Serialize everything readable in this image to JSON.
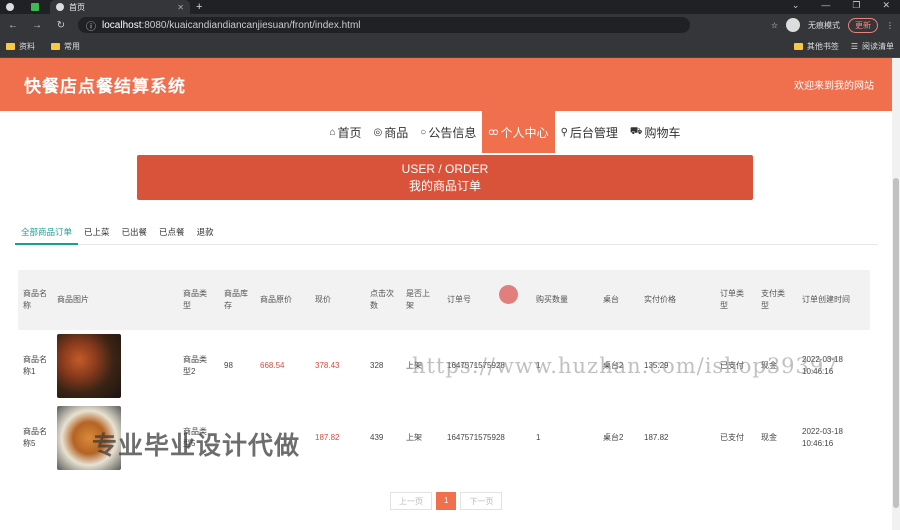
{
  "browser": {
    "tab_title": "首页",
    "url_host": "localhost",
    "url_rest": ":8080/kuaicandiandiancanjiesuan/front/index.html",
    "incognito_label": "无痕模式",
    "update_label": "更新",
    "bookmarks": [
      "资料",
      "常用"
    ],
    "bookmarks_right": [
      "其他书签",
      "阅读清单"
    ]
  },
  "site": {
    "title": "快餐店点餐结算系统",
    "welcome": "欢迎来到我的网站"
  },
  "nav": [
    {
      "icon": "home-icon",
      "glyph": "⌂",
      "label": "首页"
    },
    {
      "icon": "goods-icon",
      "glyph": "◎",
      "label": "商品"
    },
    {
      "icon": "notice-icon",
      "glyph": "○",
      "label": "公告信息"
    },
    {
      "icon": "user-icon",
      "glyph": "ꝏ",
      "label": "个人中心"
    },
    {
      "icon": "admin-icon",
      "glyph": "⚲",
      "label": "后台管理"
    },
    {
      "icon": "cart-icon",
      "glyph": "⛟",
      "label": "购物车"
    }
  ],
  "banner": {
    "line1": "USER / ORDER",
    "line2": "我的商品订单"
  },
  "order_tabs": [
    "全部商品订单",
    "已上菜",
    "已出餐",
    "已点餐",
    "退款"
  ],
  "table": {
    "headers": [
      "商品名称",
      "商品图片",
      "商品类型",
      "商品库存",
      "商品原价",
      "现价",
      "点击次数",
      "是否上架",
      "订单号",
      "",
      "购买数量",
      "桌台",
      "实付价格",
      "订单类型",
      "支付类型",
      "订单创建时间"
    ],
    "rows": [
      {
        "name": "商品名称1",
        "type": "商品类型2",
        "stock": "98",
        "orig_price": "668.54",
        "price": "378.43",
        "clicks": "328",
        "on_shelf": "上架",
        "order_no": "1647571575928",
        "qty": "1",
        "table": "桌台2",
        "paid": "135.29",
        "order_type": "已支付",
        "pay_type": "现金",
        "created": "2022-03-18 10:46:16"
      },
      {
        "name": "商品名称5",
        "type": "商品类型5",
        "stock": "",
        "orig_price": "",
        "price": "187.82",
        "clicks": "439",
        "on_shelf": "上架",
        "order_no": "1647571575928",
        "qty": "1",
        "table": "桌台2",
        "paid": "187.82",
        "order_type": "已支付",
        "pay_type": "现金",
        "created": "2022-03-18 10:46:16"
      }
    ]
  },
  "pager": {
    "prev": "上一页",
    "current": "1",
    "next": "下一页"
  },
  "watermarks": {
    "url": "https://www.huzhan.com/ishop39397",
    "promo": "专业毕业设计代做"
  },
  "colors": {
    "primary": "#f0704e",
    "banner": "#d9533a",
    "accent_tab": "#1a9f8f",
    "price": "#d94a3a"
  }
}
